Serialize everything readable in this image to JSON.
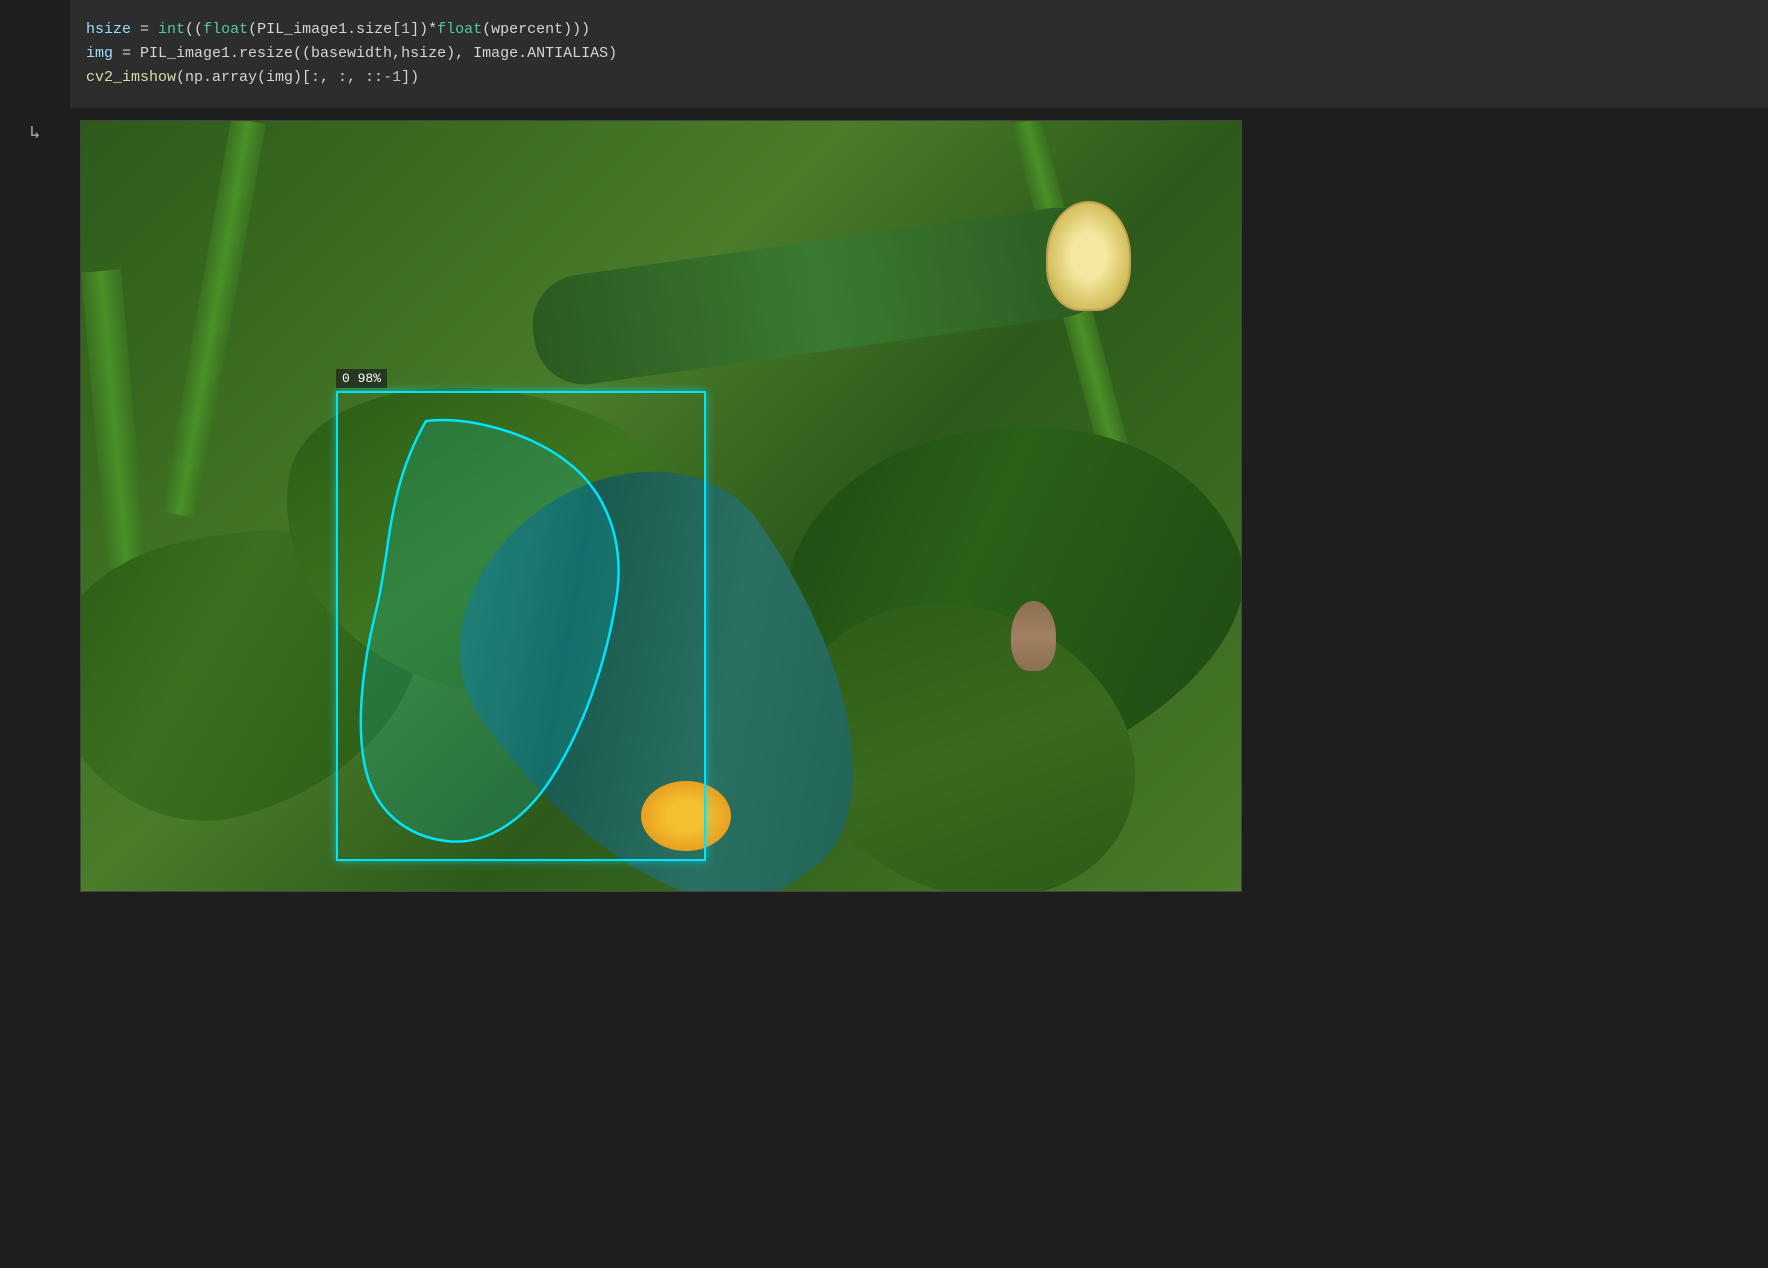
{
  "cell": {
    "code_lines": [
      {
        "id": "line1",
        "parts": [
          {
            "text": "hsize",
            "class": "kw-var"
          },
          {
            "text": " = ",
            "class": "kw-white"
          },
          {
            "text": "int",
            "class": "kw-builtin"
          },
          {
            "text": "((",
            "class": "kw-white"
          },
          {
            "text": "float",
            "class": "kw-builtin"
          },
          {
            "text": "(PIL_image1.size[",
            "class": "kw-white"
          },
          {
            "text": "1",
            "class": "kw-num"
          },
          {
            "text": "])*",
            "class": "kw-white"
          },
          {
            "text": "float",
            "class": "kw-builtin"
          },
          {
            "text": "(wpercent)))",
            "class": "kw-white"
          }
        ]
      },
      {
        "id": "line2",
        "parts": [
          {
            "text": "img",
            "class": "kw-var"
          },
          {
            "text": " = PIL_image1.resize((basewidth,hsize), Image.ANTIALIAS)",
            "class": "kw-white"
          }
        ]
      },
      {
        "id": "line3",
        "parts": [
          {
            "text": "cv2_imshow",
            "class": "kw-func"
          },
          {
            "text": "(np.array(img)[",
            "class": "kw-white"
          },
          {
            "text": ":",
            "class": "kw-white"
          },
          {
            "text": ", ",
            "class": "kw-white"
          },
          {
            "text": ":",
            "class": "kw-white"
          },
          {
            "text": ", ::",
            "class": "kw-white"
          },
          {
            "text": "-1",
            "class": "kw-num"
          },
          {
            "text": "])",
            "class": "kw-white"
          }
        ]
      }
    ],
    "detection": {
      "label": "0 98%",
      "confidence": "98%",
      "class_id": "0",
      "box_color": "#00e5ff"
    }
  },
  "gutter": {
    "output_icon": "↳"
  }
}
